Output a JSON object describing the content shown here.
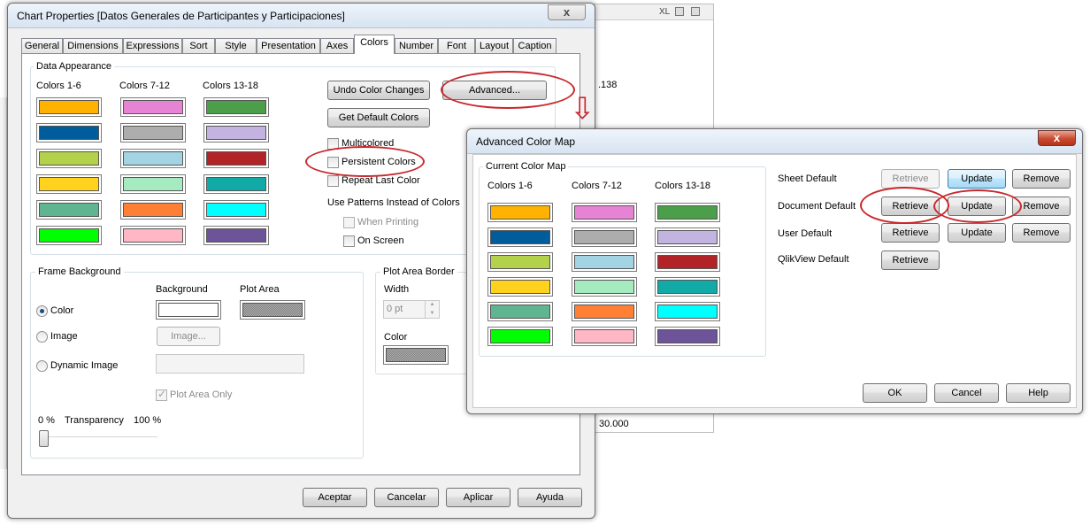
{
  "background_app": {
    "toolbar_text": "XL",
    "value_a": ".138",
    "value_b": "30.000"
  },
  "chart_properties": {
    "title": "Chart Properties [Datos Generales de Participantes y Participaciones]",
    "close_label": "x",
    "tabs": [
      "General",
      "Dimensions",
      "Expressions",
      "Sort",
      "Style",
      "Presentation",
      "Axes",
      "Colors",
      "Number",
      "Font",
      "Layout",
      "Caption"
    ],
    "active_tab": "Colors",
    "data_appearance": {
      "group_label": "Data Appearance",
      "col1_label": "Colors 1-6",
      "col2_label": "Colors 7-12",
      "col3_label": "Colors 13-18",
      "colors_1_6": [
        "#FFB300",
        "#005C9B",
        "#B4D14B",
        "#FFD21E",
        "#5EB590",
        "#00FF00"
      ],
      "colors_7_12": [
        "#E783D4",
        "#ADADAD",
        "#A2D4E4",
        "#A6EBC0",
        "#FF7F34",
        "#FFB6C5"
      ],
      "colors_13_18": [
        "#4C9F4A",
        "#C3B3E0",
        "#B22327",
        "#11AAA6",
        "#00FFFF",
        "#6D5499"
      ],
      "undo_button": "Undo Color Changes",
      "advanced_button": "Advanced...",
      "default_colors_button": "Get Default Colors",
      "multicolored": "Multicolored",
      "persistent_colors": "Persistent Colors",
      "repeat_last_color": "Repeat Last Color",
      "patterns_label": "Use Patterns Instead of Colors",
      "when_printing": "When Printing",
      "on_screen": "On Screen"
    },
    "frame_background": {
      "group_label": "Frame Background",
      "background_col": "Background",
      "plot_area_col": "Plot Area",
      "color_option": "Color",
      "image_option": "Image",
      "dynamic_image_option": "Dynamic Image",
      "image_button": "Image...",
      "plot_area_only": "Plot Area Only",
      "transparency_min": "0 %",
      "transparency_label": "Transparency",
      "transparency_max": "100 %",
      "transparency_value": 0,
      "background_color": "#FFFFFF"
    },
    "plot_area_border": {
      "group_label": "Plot Area Border",
      "width_label": "Width",
      "width_value": "0 pt",
      "color_label": "Color"
    },
    "footer": {
      "accept": "Aceptar",
      "cancel": "Cancelar",
      "apply": "Aplicar",
      "help": "Ayuda"
    }
  },
  "advanced_color_map": {
    "title": "Advanced Color Map",
    "close_label": "x",
    "group_label": "Current Color Map",
    "col1_label": "Colors 1-6",
    "col2_label": "Colors 7-12",
    "col3_label": "Colors 13-18",
    "rows": [
      {
        "label": "Sheet Default",
        "retrieve": "Retrieve",
        "update": "Update",
        "remove": "Remove"
      },
      {
        "label": "Document Default",
        "retrieve": "Retrieve",
        "update": "Update",
        "remove": "Remove"
      },
      {
        "label": "User Default",
        "retrieve": "Retrieve",
        "update": "Update",
        "remove": "Remove"
      },
      {
        "label": "QlikView Default",
        "retrieve": "Retrieve"
      }
    ],
    "ok": "OK",
    "cancel": "Cancel",
    "help": "Help"
  },
  "annotation_arrow": "⇩",
  "accent_colors": {
    "annotation_red": "#C8282D",
    "focus_blue": "#3C7FB1"
  }
}
